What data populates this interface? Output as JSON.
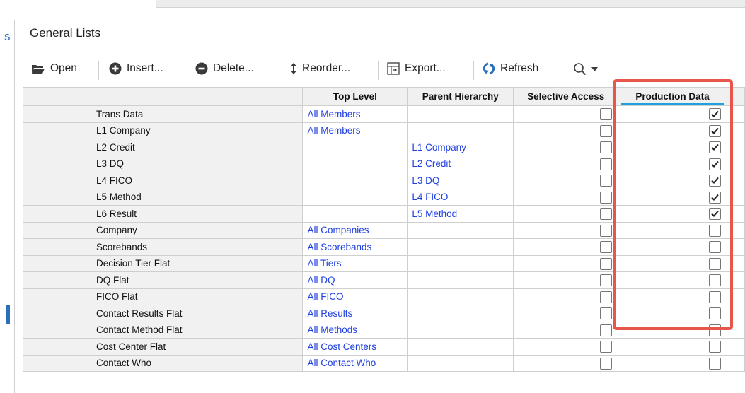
{
  "panel": {
    "title": "General Lists"
  },
  "sidebar": {
    "letter": "s"
  },
  "toolbar": {
    "open_label": "Open",
    "insert_label": "Insert...",
    "delete_label": "Delete...",
    "reorder_label": "Reorder...",
    "export_label": "Export...",
    "refresh_label": "Refresh"
  },
  "table": {
    "columns": [
      "",
      "Top Level",
      "Parent Hierarchy",
      "Selective Access",
      "Production Data"
    ],
    "rows": [
      {
        "name": "Trans Data",
        "top_level": "All Members",
        "parent": "",
        "selective": false,
        "production": true
      },
      {
        "name": "L1 Company",
        "top_level": "All Members",
        "parent": "",
        "selective": false,
        "production": true
      },
      {
        "name": "L2 Credit",
        "top_level": "",
        "parent": "L1 Company",
        "selective": false,
        "production": true
      },
      {
        "name": "L3 DQ",
        "top_level": "",
        "parent": "L2 Credit",
        "selective": false,
        "production": true
      },
      {
        "name": "L4 FICO",
        "top_level": "",
        "parent": "L3 DQ",
        "selective": false,
        "production": true
      },
      {
        "name": "L5 Method",
        "top_level": "",
        "parent": "L4 FICO",
        "selective": false,
        "production": true
      },
      {
        "name": "L6 Result",
        "top_level": "",
        "parent": "L5 Method",
        "selective": false,
        "production": true
      },
      {
        "name": "Company",
        "top_level": "All Companies",
        "parent": "",
        "selective": false,
        "production": false
      },
      {
        "name": "Scorebands",
        "top_level": "All Scorebands",
        "parent": "",
        "selective": false,
        "production": false
      },
      {
        "name": "Decision Tier Flat",
        "top_level": "All Tiers",
        "parent": "",
        "selective": false,
        "production": false
      },
      {
        "name": "DQ Flat",
        "top_level": "All DQ",
        "parent": "",
        "selective": false,
        "production": false
      },
      {
        "name": "FICO Flat",
        "top_level": "All FICO",
        "parent": "",
        "selective": false,
        "production": false
      },
      {
        "name": "Contact Results Flat",
        "top_level": "All Results",
        "parent": "",
        "selective": false,
        "production": false
      },
      {
        "name": "Contact Method Flat",
        "top_level": "All Methods",
        "parent": "",
        "selective": false,
        "production": false
      },
      {
        "name": "Cost Center Flat",
        "top_level": "All Cost Centers",
        "parent": "",
        "selective": false,
        "production": false
      },
      {
        "name": "Contact Who",
        "top_level": "All Contact Who",
        "parent": "",
        "selective": false,
        "production": false
      }
    ]
  },
  "colors": {
    "link": "#1f3fe0",
    "highlight": "#e8554a",
    "underline": "#1e9fe0"
  }
}
